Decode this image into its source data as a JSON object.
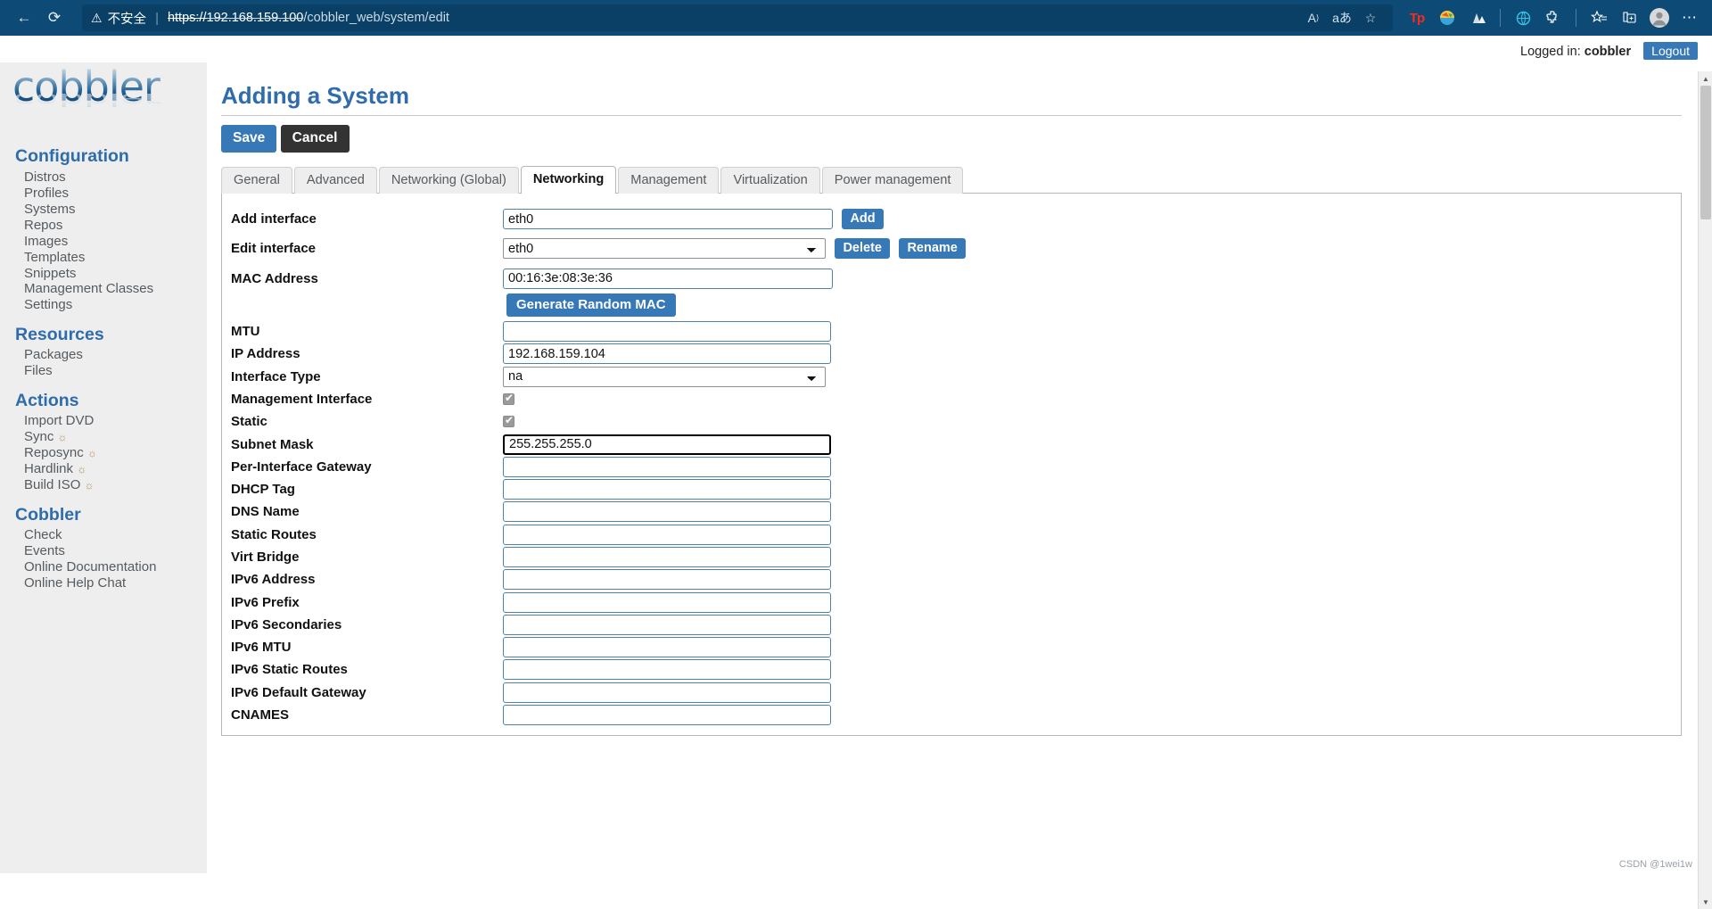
{
  "browser": {
    "back_icon": "back-arrow-icon",
    "reload_icon": "reload-icon",
    "security_warning": "不安全",
    "url_scheme": "https://",
    "url_host": "192.168.159.100",
    "url_path": "/cobbler_web/system/edit",
    "pill_icons": [
      "read-aloud-icon",
      "translate-icon",
      "add-favorite-icon"
    ],
    "extension_icons": [
      "tp-extension-icon",
      "colorful-extension-icon",
      "mountain-extension-icon"
    ],
    "right_icons": [
      "browser-essentials-icon",
      "extensions-icon",
      "favorites-icon",
      "collections-icon",
      "profile-icon",
      "settings-more-icon"
    ],
    "tp_label": "Tp"
  },
  "topbar": {
    "logged_in_prefix": "Logged in:",
    "username": "cobbler",
    "logout_label": "Logout"
  },
  "sidebar": {
    "logo_text": "cobbler",
    "sections": [
      {
        "heading": "Configuration",
        "items": [
          {
            "label": "Distros",
            "gear": false
          },
          {
            "label": "Profiles",
            "gear": false
          },
          {
            "label": "Systems",
            "gear": false
          },
          {
            "label": "Repos",
            "gear": false
          },
          {
            "label": "Images",
            "gear": false
          },
          {
            "label": "Templates",
            "gear": false
          },
          {
            "label": "Snippets",
            "gear": false
          },
          {
            "label": "Management Classes",
            "gear": false
          },
          {
            "label": "Settings",
            "gear": false
          }
        ]
      },
      {
        "heading": "Resources",
        "items": [
          {
            "label": "Packages",
            "gear": false
          },
          {
            "label": "Files",
            "gear": false
          }
        ]
      },
      {
        "heading": "Actions",
        "items": [
          {
            "label": "Import DVD",
            "gear": false
          },
          {
            "label": "Sync",
            "gear": true
          },
          {
            "label": "Reposync",
            "gear": true
          },
          {
            "label": "Hardlink",
            "gear": true
          },
          {
            "label": "Build ISO",
            "gear": true
          }
        ]
      },
      {
        "heading": "Cobbler",
        "items": [
          {
            "label": "Check",
            "gear": false
          },
          {
            "label": "Events",
            "gear": false
          },
          {
            "label": "Online Documentation",
            "gear": false
          },
          {
            "label": "Online Help Chat",
            "gear": false
          }
        ]
      }
    ]
  },
  "main": {
    "page_title": "Adding a System",
    "save_label": "Save",
    "cancel_label": "Cancel",
    "tabs": [
      {
        "label": "General",
        "active": false
      },
      {
        "label": "Advanced",
        "active": false
      },
      {
        "label": "Networking (Global)",
        "active": false
      },
      {
        "label": "Networking",
        "active": true
      },
      {
        "label": "Management",
        "active": false
      },
      {
        "label": "Virtualization",
        "active": false
      },
      {
        "label": "Power management",
        "active": false
      }
    ],
    "form": {
      "add_interface": {
        "label": "Add interface",
        "value": "eth0",
        "button": "Add"
      },
      "edit_interface": {
        "label": "Edit interface",
        "value": "eth0",
        "options": [
          "eth0"
        ],
        "delete": "Delete",
        "rename": "Rename"
      },
      "mac_address": {
        "label": "MAC Address",
        "value": "00:16:3e:08:3e:36"
      },
      "generate_mac": "Generate Random MAC",
      "mtu": {
        "label": "MTU",
        "value": ""
      },
      "ip_address": {
        "label": "IP Address",
        "value": "192.168.159.104"
      },
      "interface_type": {
        "label": "Interface Type",
        "value": "na",
        "options": [
          "na"
        ]
      },
      "management_interface": {
        "label": "Management Interface",
        "checked": true
      },
      "static": {
        "label": "Static",
        "checked": true
      },
      "subnet_mask": {
        "label": "Subnet Mask",
        "value": "255.255.255.0",
        "focused": true
      },
      "per_interface_gateway": {
        "label": "Per-Interface Gateway",
        "value": ""
      },
      "dhcp_tag": {
        "label": "DHCP Tag",
        "value": ""
      },
      "dns_name": {
        "label": "DNS Name",
        "value": ""
      },
      "static_routes": {
        "label": "Static Routes",
        "value": ""
      },
      "virt_bridge": {
        "label": "Virt Bridge",
        "value": ""
      },
      "ipv6_address": {
        "label": "IPv6 Address",
        "value": ""
      },
      "ipv6_prefix": {
        "label": "IPv6 Prefix",
        "value": ""
      },
      "ipv6_secondaries": {
        "label": "IPv6 Secondaries",
        "value": ""
      },
      "ipv6_mtu": {
        "label": "IPv6 MTU",
        "value": ""
      },
      "ipv6_static_routes": {
        "label": "IPv6 Static Routes",
        "value": ""
      },
      "ipv6_default_gateway": {
        "label": "IPv6 Default Gateway",
        "value": ""
      },
      "cnames": {
        "label": "CNAMES",
        "value": ""
      }
    }
  },
  "watermark": "CSDN @1wei1w"
}
